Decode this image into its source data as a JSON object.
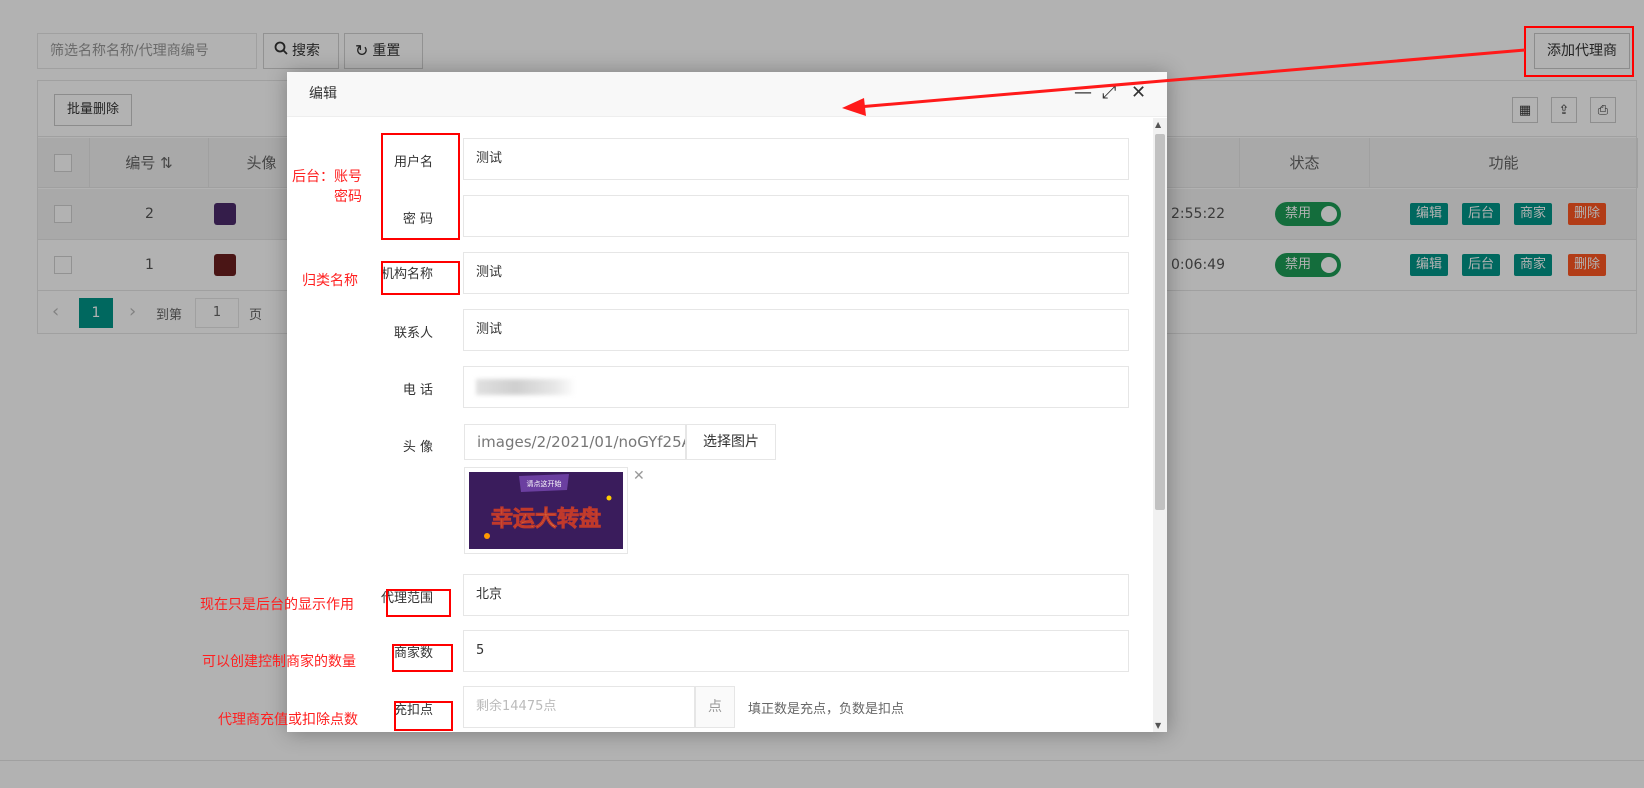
{
  "filter": {
    "placeholder": "筛选名称名称/代理商编号",
    "search_label": "搜索",
    "reset_label": "重置"
  },
  "add_agent_label": "添加代理商",
  "batch_delete_label": "批量删除",
  "table": {
    "headers": [
      "编号",
      "头像",
      "状态",
      "功能"
    ],
    "rows": [
      {
        "id": "2",
        "time": "2:55:22",
        "status": "禁用"
      },
      {
        "id": "1",
        "time": "0:06:49",
        "status": "禁用"
      }
    ],
    "fn_buttons": [
      "编辑",
      "后台",
      "商家",
      "删除"
    ]
  },
  "pager": {
    "current": "1",
    "goto_label": "到第",
    "page_value": "1",
    "page_unit": "页"
  },
  "modal": {
    "title": "编辑",
    "fields": {
      "username": {
        "label": "用户名",
        "value": "测试"
      },
      "password": {
        "label": "密 码",
        "value": ""
      },
      "org_name": {
        "label": "机构名称",
        "value": "测试"
      },
      "contact": {
        "label": "联系人",
        "value": "测试"
      },
      "phone": {
        "label": "电 话"
      },
      "avatar": {
        "label": "头 像",
        "path": "images/2/2021/01/noGYf25A",
        "choose_label": "选择图片"
      },
      "scope": {
        "label": "代理范围",
        "value": "北京"
      },
      "merchant_count": {
        "label": "商家数",
        "value": "5"
      },
      "points": {
        "label": "充扣点",
        "placeholder": "剩余14475点",
        "unit": "点",
        "hint": "填正数是充点，负数是扣点"
      }
    },
    "thumb_text": {
      "top": "请点这开始",
      "main": "幸运大转盘"
    }
  },
  "annotations": {
    "backend_account": "后台：账号\n密码",
    "category_name": "归类名称",
    "display_only": "现在只是后台的显示作用",
    "merchant_limit": "可以创建控制商家的数量",
    "points_note": "代理商充值或扣除点数"
  },
  "colors": {
    "teal": "#009688",
    "red": "#ff5722",
    "green": "#1e9c56",
    "annotation": "#ff0000"
  }
}
